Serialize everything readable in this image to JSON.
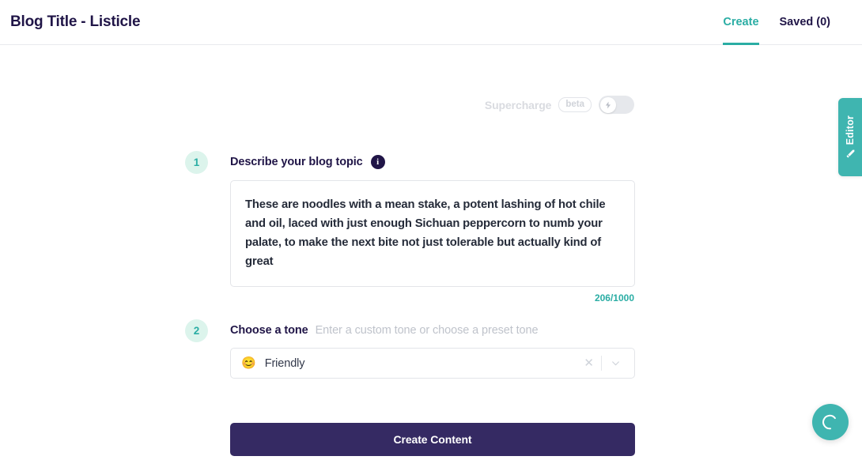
{
  "header": {
    "app_title": "Blog Title - Listicle",
    "nav": [
      {
        "label": "Create",
        "active": true
      },
      {
        "label": "Saved (0)",
        "active": false
      }
    ]
  },
  "supercharge": {
    "label": "Supercharge",
    "badge": "beta",
    "toggle_state": "off",
    "icon": "lightning-bolt-icon"
  },
  "steps": [
    {
      "number": "1",
      "label": "Describe your blog topic",
      "info_icon": "info-icon"
    },
    {
      "number": "2",
      "label": "Choose a tone",
      "hint": "Enter a custom tone or choose a preset tone"
    }
  ],
  "topic": {
    "value": "These are noodles with a mean stake, a potent lashing of hot chile and oil, laced with just enough Sichuan peppercorn to numb your palate, to make the next bite not just tolerable but actually kind of great",
    "placeholder": "",
    "char_count": "206/1000"
  },
  "tone": {
    "emoji": "😊",
    "value": "Friendly",
    "placeholder": "Enter a custom tone or choose a preset tone",
    "clear_label": "✕",
    "chevron_icon": "chevron-down-icon"
  },
  "submit": {
    "label": "Create Content"
  },
  "editor_tab": {
    "label": "Editor",
    "icon": "pencil-icon"
  },
  "chat_fab": {
    "label": "C",
    "icon": "chat-widget-icon"
  },
  "colors": {
    "teal": "#2aada4",
    "teal_bright": "#3fb5b0",
    "navy": "#201547",
    "purple": "#352a63",
    "mint": "#dcf4ec",
    "muted": "#bfc3cb",
    "border": "#e3e5e9"
  }
}
